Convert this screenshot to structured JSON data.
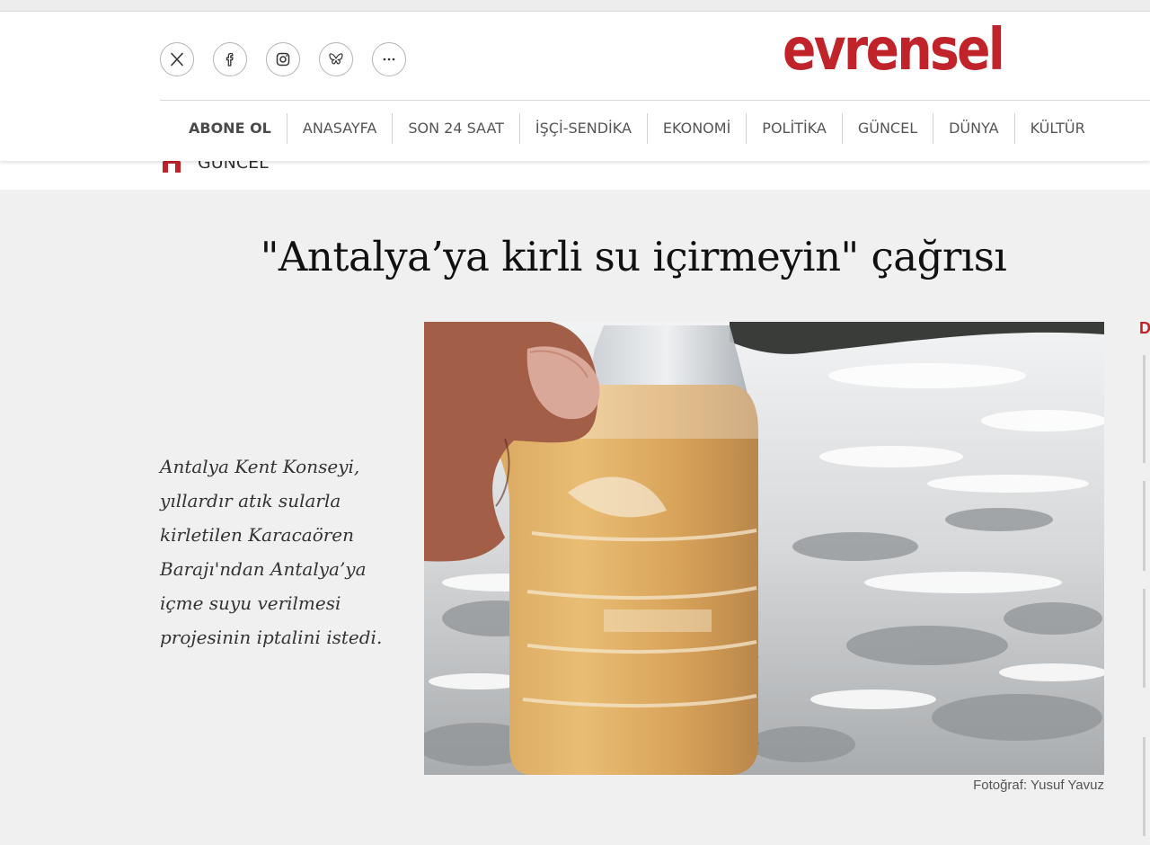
{
  "brand": {
    "logo_text": "evrensel",
    "accent": "#c0242a"
  },
  "social": [
    {
      "icon": "x-icon",
      "label": "X"
    },
    {
      "icon": "facebook-icon",
      "label": "Facebook"
    },
    {
      "icon": "instagram-icon",
      "label": "Instagram"
    },
    {
      "icon": "bluesky-icon",
      "label": "Bluesky"
    },
    {
      "icon": "more-icon",
      "label": "More"
    }
  ],
  "nav": {
    "items": [
      "ABONE OL",
      "ANASAYFA",
      "SON 24 SAAT",
      "İŞÇİ-SENDİKA",
      "EKONOMİ",
      "POLİTİKA",
      "GÜNCEL",
      "DÜNYA",
      "KÜLTÜR"
    ]
  },
  "breadcrumb": {
    "icon": "home-icon",
    "label": "GÜNCEL"
  },
  "article": {
    "title": "\"Antalya’ya kirli su içirmeyin\" çağrısı",
    "summary": "Antalya Kent Konseyi, yıllardır atık sularla kirletilen Karacaören Barajı'ndan Antalya’ya içme suyu verilmesi projesinin iptalini istedi.",
    "photo_credit": "Fotoğraf: Yusuf Yavuz"
  },
  "sidebar": {
    "peek_char": "D"
  }
}
